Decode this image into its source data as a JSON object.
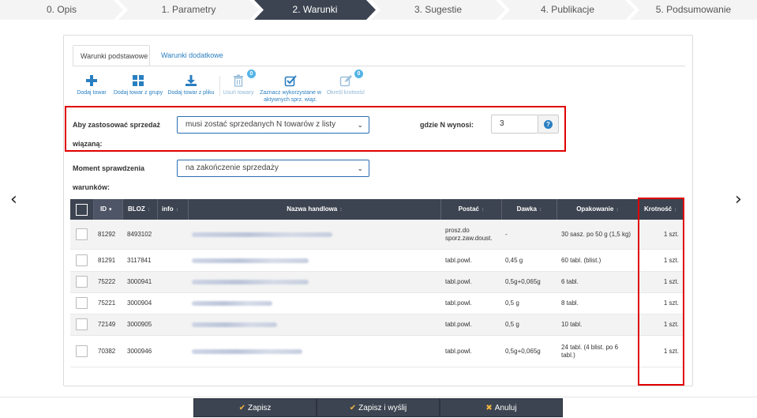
{
  "steps": [
    "0. Opis",
    "1. Parametry",
    "2. Warunki",
    "3. Sugestie",
    "4. Publikacje",
    "5. Podsumowanie"
  ],
  "tabs": {
    "basic": "Warunki podstawowe",
    "extra": "Warunki dodatkowe"
  },
  "toolbar": {
    "add_product": "Dodaj towar",
    "add_group": "Dodaj towar z grupy",
    "add_file": "Dodaj towar z pliku",
    "remove": "Usuń towary",
    "remove_badge": "0",
    "mark_line1": "Zaznacz wykorzystane w",
    "mark_line2": "aktywnych sprz. wiąz.",
    "multiplicity": "Określ krotność",
    "multiplicity_badge": "0"
  },
  "form": {
    "apply_label_1": "Aby zastosować sprzedaż",
    "apply_label_2": "wiązaną:",
    "apply_value": "musi zostać sprzedanych N towarów z listy",
    "n_label": "gdzie N wynosi:",
    "n_value": "3",
    "moment_label_1": "Moment sprawdzenia",
    "moment_label_2": "warunków:",
    "moment_value": "na zakończenie sprzedaży"
  },
  "table": {
    "headers": {
      "id": "ID",
      "bloz": "BLOZ",
      "info": "info",
      "name": "Nazwa handlowa",
      "form": "Postać",
      "dose": "Dawka",
      "package": "Opakowanie",
      "multiplicity": "Krotność"
    },
    "rows": [
      {
        "id": "81292",
        "bloz": "8493102",
        "form_l1": "prosz.do",
        "form_l2": "sporz.zaw.doust.",
        "dose": "-",
        "pkg_l1": "30 sasz. po 50 g (1,5 kg)",
        "pkg_l2": "",
        "mult": "1 szt."
      },
      {
        "id": "81291",
        "bloz": "3117841",
        "form_l1": "tabl.powl.",
        "form_l2": "",
        "dose": "0,45 g",
        "pkg_l1": "60 tabl. (blist.)",
        "pkg_l2": "",
        "mult": "1 szt."
      },
      {
        "id": "75222",
        "bloz": "3000941",
        "form_l1": "tabl.powl.",
        "form_l2": "",
        "dose": "0,5g+0,065g",
        "pkg_l1": "6 tabl.",
        "pkg_l2": "",
        "mult": "1 szt."
      },
      {
        "id": "75221",
        "bloz": "3000904",
        "form_l1": "tabl.powl.",
        "form_l2": "",
        "dose": "0,5 g",
        "pkg_l1": "8 tabl.",
        "pkg_l2": "",
        "mult": "1 szt."
      },
      {
        "id": "72149",
        "bloz": "3000905",
        "form_l1": "tabl.powl.",
        "form_l2": "",
        "dose": "0,5 g",
        "pkg_l1": "10 tabl.",
        "pkg_l2": "",
        "mult": "1 szt."
      },
      {
        "id": "70382",
        "bloz": "3000946",
        "form_l1": "tabl.powl.",
        "form_l2": "",
        "dose": "0,5g+0,065g",
        "pkg_l1": "24 tabl. (4 blist. po 6",
        "pkg_l2": "tabl.)",
        "mult": "1 szt."
      }
    ]
  },
  "footer": {
    "save": "Zapisz",
    "save_send": "Zapisz i wyślij",
    "cancel": "Anuluj"
  },
  "colors": {
    "dark": "#3d4451",
    "accent": "#2a7fc1",
    "highlight": "#e00000",
    "tick": "#f3b53f"
  }
}
